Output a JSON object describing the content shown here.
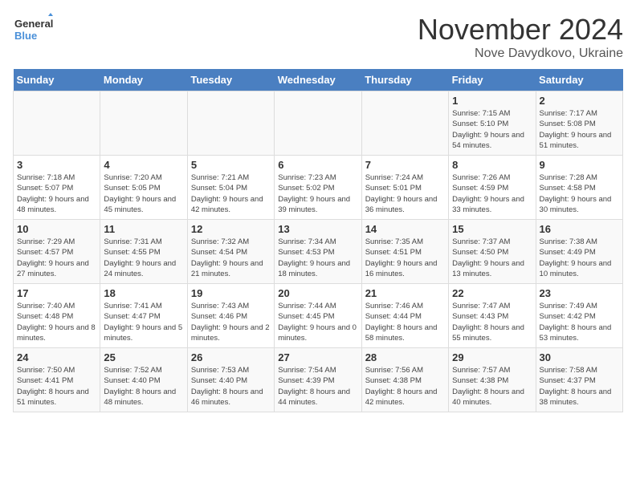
{
  "logo": {
    "line1": "General",
    "line2": "Blue"
  },
  "title": "November 2024",
  "subtitle": "Nove Davydkovo, Ukraine",
  "days_of_week": [
    "Sunday",
    "Monday",
    "Tuesday",
    "Wednesday",
    "Thursday",
    "Friday",
    "Saturday"
  ],
  "weeks": [
    [
      {
        "day": "",
        "info": ""
      },
      {
        "day": "",
        "info": ""
      },
      {
        "day": "",
        "info": ""
      },
      {
        "day": "",
        "info": ""
      },
      {
        "day": "",
        "info": ""
      },
      {
        "day": "1",
        "info": "Sunrise: 7:15 AM\nSunset: 5:10 PM\nDaylight: 9 hours and 54 minutes."
      },
      {
        "day": "2",
        "info": "Sunrise: 7:17 AM\nSunset: 5:08 PM\nDaylight: 9 hours and 51 minutes."
      }
    ],
    [
      {
        "day": "3",
        "info": "Sunrise: 7:18 AM\nSunset: 5:07 PM\nDaylight: 9 hours and 48 minutes."
      },
      {
        "day": "4",
        "info": "Sunrise: 7:20 AM\nSunset: 5:05 PM\nDaylight: 9 hours and 45 minutes."
      },
      {
        "day": "5",
        "info": "Sunrise: 7:21 AM\nSunset: 5:04 PM\nDaylight: 9 hours and 42 minutes."
      },
      {
        "day": "6",
        "info": "Sunrise: 7:23 AM\nSunset: 5:02 PM\nDaylight: 9 hours and 39 minutes."
      },
      {
        "day": "7",
        "info": "Sunrise: 7:24 AM\nSunset: 5:01 PM\nDaylight: 9 hours and 36 minutes."
      },
      {
        "day": "8",
        "info": "Sunrise: 7:26 AM\nSunset: 4:59 PM\nDaylight: 9 hours and 33 minutes."
      },
      {
        "day": "9",
        "info": "Sunrise: 7:28 AM\nSunset: 4:58 PM\nDaylight: 9 hours and 30 minutes."
      }
    ],
    [
      {
        "day": "10",
        "info": "Sunrise: 7:29 AM\nSunset: 4:57 PM\nDaylight: 9 hours and 27 minutes."
      },
      {
        "day": "11",
        "info": "Sunrise: 7:31 AM\nSunset: 4:55 PM\nDaylight: 9 hours and 24 minutes."
      },
      {
        "day": "12",
        "info": "Sunrise: 7:32 AM\nSunset: 4:54 PM\nDaylight: 9 hours and 21 minutes."
      },
      {
        "day": "13",
        "info": "Sunrise: 7:34 AM\nSunset: 4:53 PM\nDaylight: 9 hours and 18 minutes."
      },
      {
        "day": "14",
        "info": "Sunrise: 7:35 AM\nSunset: 4:51 PM\nDaylight: 9 hours and 16 minutes."
      },
      {
        "day": "15",
        "info": "Sunrise: 7:37 AM\nSunset: 4:50 PM\nDaylight: 9 hours and 13 minutes."
      },
      {
        "day": "16",
        "info": "Sunrise: 7:38 AM\nSunset: 4:49 PM\nDaylight: 9 hours and 10 minutes."
      }
    ],
    [
      {
        "day": "17",
        "info": "Sunrise: 7:40 AM\nSunset: 4:48 PM\nDaylight: 9 hours and 8 minutes."
      },
      {
        "day": "18",
        "info": "Sunrise: 7:41 AM\nSunset: 4:47 PM\nDaylight: 9 hours and 5 minutes."
      },
      {
        "day": "19",
        "info": "Sunrise: 7:43 AM\nSunset: 4:46 PM\nDaylight: 9 hours and 2 minutes."
      },
      {
        "day": "20",
        "info": "Sunrise: 7:44 AM\nSunset: 4:45 PM\nDaylight: 9 hours and 0 minutes."
      },
      {
        "day": "21",
        "info": "Sunrise: 7:46 AM\nSunset: 4:44 PM\nDaylight: 8 hours and 58 minutes."
      },
      {
        "day": "22",
        "info": "Sunrise: 7:47 AM\nSunset: 4:43 PM\nDaylight: 8 hours and 55 minutes."
      },
      {
        "day": "23",
        "info": "Sunrise: 7:49 AM\nSunset: 4:42 PM\nDaylight: 8 hours and 53 minutes."
      }
    ],
    [
      {
        "day": "24",
        "info": "Sunrise: 7:50 AM\nSunset: 4:41 PM\nDaylight: 8 hours and 51 minutes."
      },
      {
        "day": "25",
        "info": "Sunrise: 7:52 AM\nSunset: 4:40 PM\nDaylight: 8 hours and 48 minutes."
      },
      {
        "day": "26",
        "info": "Sunrise: 7:53 AM\nSunset: 4:40 PM\nDaylight: 8 hours and 46 minutes."
      },
      {
        "day": "27",
        "info": "Sunrise: 7:54 AM\nSunset: 4:39 PM\nDaylight: 8 hours and 44 minutes."
      },
      {
        "day": "28",
        "info": "Sunrise: 7:56 AM\nSunset: 4:38 PM\nDaylight: 8 hours and 42 minutes."
      },
      {
        "day": "29",
        "info": "Sunrise: 7:57 AM\nSunset: 4:38 PM\nDaylight: 8 hours and 40 minutes."
      },
      {
        "day": "30",
        "info": "Sunrise: 7:58 AM\nSunset: 4:37 PM\nDaylight: 8 hours and 38 minutes."
      }
    ]
  ]
}
